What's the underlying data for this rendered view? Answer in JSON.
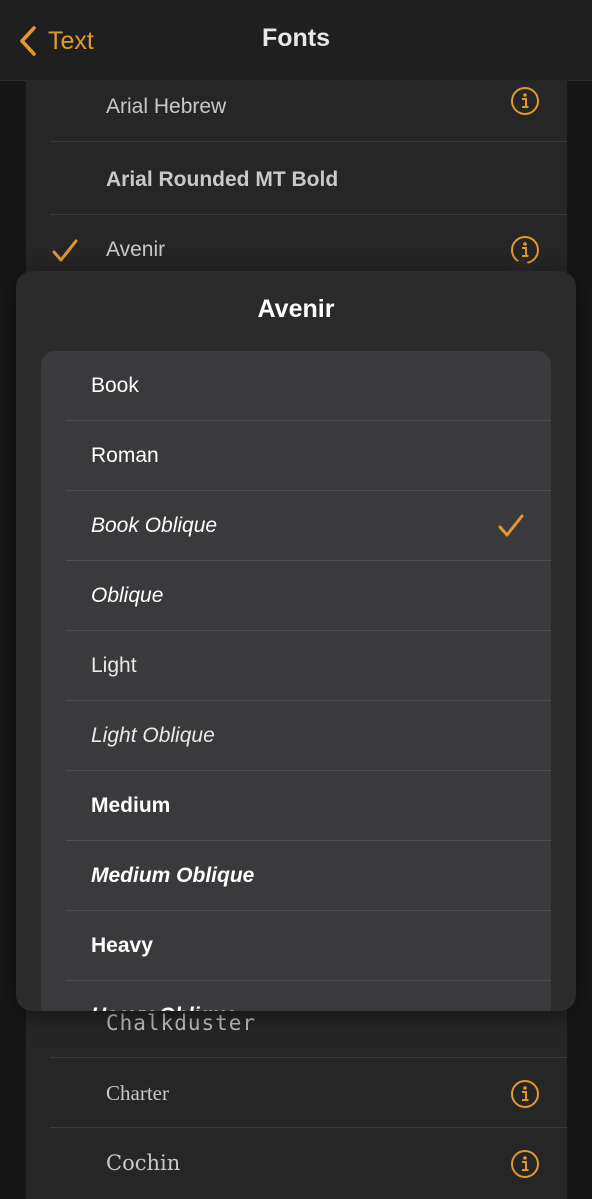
{
  "nav": {
    "back_label": "Text",
    "title": "Fonts"
  },
  "font_list": {
    "above": [
      {
        "name": "Arial Hebrew",
        "has_info": true,
        "selected": false
      },
      {
        "name": "Arial Rounded MT Bold",
        "has_info": false,
        "selected": false
      },
      {
        "name": "Avenir",
        "has_info": true,
        "selected": true
      }
    ],
    "below": [
      {
        "name": "Chalkduster",
        "has_info": false,
        "selected": false
      },
      {
        "name": "Charter",
        "has_info": true,
        "selected": false
      },
      {
        "name": "Cochin",
        "has_info": true,
        "selected": false
      }
    ]
  },
  "popover": {
    "title": "Avenir",
    "styles": [
      {
        "name": "Book",
        "selected": false
      },
      {
        "name": "Roman",
        "selected": false
      },
      {
        "name": "Book Oblique",
        "selected": true
      },
      {
        "name": "Oblique",
        "selected": false
      },
      {
        "name": "Light",
        "selected": false
      },
      {
        "name": "Light Oblique",
        "selected": false
      },
      {
        "name": "Medium",
        "selected": false
      },
      {
        "name": "Medium Oblique",
        "selected": false
      },
      {
        "name": "Heavy",
        "selected": false
      },
      {
        "name": "Heavy Oblique",
        "selected": false
      }
    ]
  },
  "colors": {
    "accent": "#e0982f",
    "background": "#171717",
    "list_panel": "#262626",
    "popover": "#2b2b2b",
    "style_panel": "#3a3a3c"
  },
  "icons": {
    "back": "chevron-left-icon",
    "info": "info-circle-icon",
    "check": "checkmark-icon"
  }
}
